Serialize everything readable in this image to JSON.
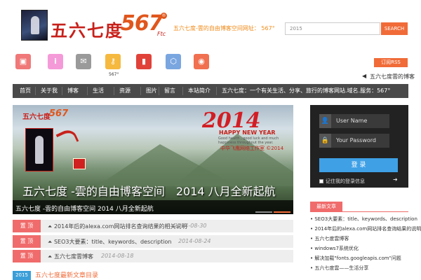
{
  "header": {
    "logo_text": "五六七度",
    "logo_num": "567",
    "logo_ftc": "Ftc",
    "logo_reg": "®",
    "tagline": "五六七度-雲的自由博客空间网址： 567°"
  },
  "search": {
    "placeholder": "2015",
    "button_label": "SEARCH"
  },
  "icons": [
    {
      "name": "bookmark-icon",
      "glyph": "▣",
      "color": "#f07878"
    },
    {
      "name": "info-icon",
      "glyph": "i",
      "color": "#f59ad8"
    },
    {
      "name": "mail-icon",
      "glyph": "✉",
      "color": "#9a9a9a"
    },
    {
      "name": "key-icon",
      "glyph": "⚷",
      "color": "#f5b940"
    },
    {
      "name": "ribbon-icon",
      "glyph": "▮",
      "color": "#e0423a"
    },
    {
      "name": "shield-icon",
      "glyph": "⬡",
      "color": "#7aa6e0"
    },
    {
      "name": "weibo-icon",
      "glyph": "◉",
      "color": "#f07050"
    }
  ],
  "icon_label": "567°",
  "rss_label": "订阅RSS",
  "announcement": "五六七度雲的博客",
  "nav": {
    "items": [
      "首页",
      "关于我",
      "博客",
      "生活",
      "资源",
      "图片",
      "留言",
      "本站简介",
      "五六七度：一个有关生活、分享、旅行的博客网站.域名.服务：567°"
    ]
  },
  "banner": {
    "logo_small": "五六七度",
    "logo_num": "567",
    "ny_year": "2014",
    "ny_text": "HAPPY NEW YEAR",
    "ny_sub": "Good health , good luck and much happiness throughout the year.",
    "studio": "中华飞鹰网络工作室 ©2014",
    "caption": "五六七度 -雲的自由博客空间　2014 八月全新起航",
    "bar_text": "五六七度 -雲的自由博客空间 2014 八月全新起航"
  },
  "news": [
    {
      "tag": "置 顶",
      "title": "2014年后的alexa.com网站排名查询结果的相关说明",
      "date": "2014-08-30"
    },
    {
      "tag": "置 顶",
      "title": "SEO3大要素：title、keywords、description",
      "date": "2014-08-24"
    },
    {
      "tag": "置 顶",
      "title": "五六七度雲博客",
      "date": "2014-08-18"
    }
  ],
  "section": {
    "year": "2015",
    "heading": "五六七度最新文章目录"
  },
  "login": {
    "username_placeholder": "User Name",
    "password_placeholder": "Your Password",
    "button_label": "登 录",
    "remember_label": "记住我的登录信息"
  },
  "sidebar": {
    "tab_label": "最新文章",
    "links": [
      "SEO3大要素：title、keywords、description",
      "2014年后的alexa.com网站排名查询结果的说明",
      "五六七度雲博客",
      "windows7系统优化",
      "解决加载\"fonts.googleapis.com\"问题",
      "五六七度雲——生活分享"
    ]
  }
}
